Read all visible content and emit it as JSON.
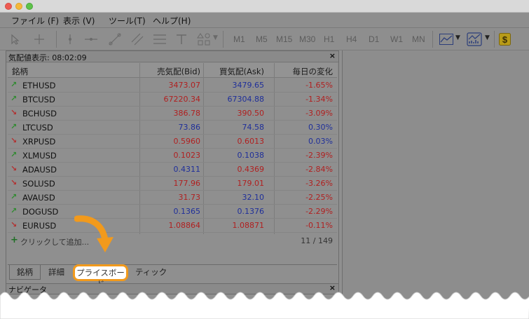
{
  "menu": [
    "ファイル (F)",
    "表示 (V)",
    "ツール(T)",
    "ヘルプ(H)"
  ],
  "toolbar": {
    "timeframes": [
      "M1",
      "M5",
      "M15",
      "M30",
      "H1",
      "H4",
      "D1",
      "W1",
      "MN"
    ]
  },
  "market_watch": {
    "title": "気配値表示: 08:02:09",
    "close": "×",
    "columns": [
      "銘柄",
      "売気配(Bid)",
      "買気配(Ask)",
      "毎日の変化"
    ],
    "rows": [
      {
        "dir": "up",
        "symbol": "ETHUSD",
        "bid": "3473.07",
        "ask": "3479.65",
        "change": "-1.65%",
        "bid_color": "#b02020",
        "ask_color": "#1f2f9a",
        "change_color": "#b02020"
      },
      {
        "dir": "up",
        "symbol": "BTCUSD",
        "bid": "67220.34",
        "ask": "67304.88",
        "change": "-1.34%",
        "bid_color": "#b02020",
        "ask_color": "#1f2f9a",
        "change_color": "#b02020"
      },
      {
        "dir": "down",
        "symbol": "BCHUSD",
        "bid": "386.78",
        "ask": "390.50",
        "change": "-3.09%",
        "bid_color": "#b02020",
        "ask_color": "#b02020",
        "change_color": "#b02020"
      },
      {
        "dir": "up",
        "symbol": "LTCUSD",
        "bid": "73.86",
        "ask": "74.58",
        "change": "0.30%",
        "bid_color": "#1f2f9a",
        "ask_color": "#1f2f9a",
        "change_color": "#1f2f9a"
      },
      {
        "dir": "down",
        "symbol": "XRPUSD",
        "bid": "0.5960",
        "ask": "0.6013",
        "change": "0.03%",
        "bid_color": "#b02020",
        "ask_color": "#b02020",
        "change_color": "#1f2f9a"
      },
      {
        "dir": "up",
        "symbol": "XLMUSD",
        "bid": "0.1023",
        "ask": "0.1038",
        "change": "-2.39%",
        "bid_color": "#b02020",
        "ask_color": "#1f2f9a",
        "change_color": "#b02020"
      },
      {
        "dir": "down",
        "symbol": "ADAUSD",
        "bid": "0.4311",
        "ask": "0.4369",
        "change": "-2.84%",
        "bid_color": "#1f2f9a",
        "ask_color": "#b02020",
        "change_color": "#b02020"
      },
      {
        "dir": "down",
        "symbol": "SOLUSD",
        "bid": "177.96",
        "ask": "179.01",
        "change": "-3.26%",
        "bid_color": "#b02020",
        "ask_color": "#b02020",
        "change_color": "#b02020"
      },
      {
        "dir": "up",
        "symbol": "AVAUSD",
        "bid": "31.73",
        "ask": "32.10",
        "change": "-2.25%",
        "bid_color": "#b02020",
        "ask_color": "#1f2f9a",
        "change_color": "#b02020"
      },
      {
        "dir": "up",
        "symbol": "DOGUSD",
        "bid": "0.1365",
        "ask": "0.1376",
        "change": "-2.29%",
        "bid_color": "#1f2f9a",
        "ask_color": "#1f2f9a",
        "change_color": "#b02020"
      },
      {
        "dir": "down",
        "symbol": "EURUSD",
        "bid": "1.08864",
        "ask": "1.08871",
        "change": "-0.11%",
        "bid_color": "#b02020",
        "ask_color": "#b02020",
        "change_color": "#b02020"
      }
    ],
    "add_label": "クリックして追加...",
    "count": "11 / 149",
    "tabs": [
      "銘柄",
      "詳細",
      "プライスボード",
      "ティック"
    ]
  },
  "navigator": {
    "title": "ナビゲータ",
    "close": "×"
  },
  "colors": {
    "up_arrow": "#2f8a2f",
    "down_arrow": "#b23030",
    "highlight": "#f29a1c"
  }
}
